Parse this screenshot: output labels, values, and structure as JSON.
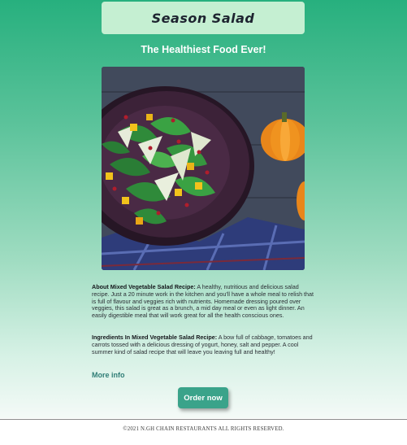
{
  "header": {
    "title": "Season Salad",
    "tagline": "The Healthiest Food Ever!"
  },
  "photo": {
    "icon": "salad-photo",
    "colors": {
      "plate": "#3c2238",
      "table": "#414a5c",
      "pumpkin": "#f0931f"
    }
  },
  "content": {
    "about_heading": "About Mixed Vegetable Salad Recipe:",
    "about_text": " A healthy, nutritious and delicious salad recipe. Just a 20 minute work in the kitchen and you'll have a whole meal to relish that is full of flavour and veggies rich with nutrients. Homemade dressing poured over veggies, this salad is great as a brunch, a mid day meal or even as light dinner. An easily digestible meal that will work great for all the health conscious ones.",
    "ingredients_heading": "Ingredients In Mixed Vegetable Salad Recipe:",
    "ingredients_text": " A bow full of cabbage, tomatoes and carrots tossed with a delicious dressing of yogurt, honey, salt and pepper. A cool summer kind of salad recipe that will leave you leaving full and healthy!",
    "more_link": "More info",
    "order_button": "Order now"
  },
  "footer": {
    "copyright": "©2021 N.GH CHAIN RESTAURANTS ALL RIGHTS RESERVED."
  },
  "colors": {
    "accent": "#3aa38a",
    "gradient_top": "#27b07e",
    "title_box": "#c5efd2",
    "link": "#2f7d76"
  }
}
